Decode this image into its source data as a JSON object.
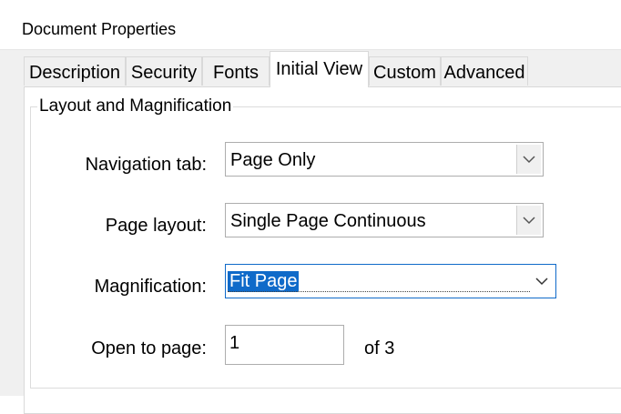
{
  "window": {
    "title": "Document Properties"
  },
  "tabs": [
    {
      "label": "Description",
      "active": false
    },
    {
      "label": "Security",
      "active": false
    },
    {
      "label": "Fonts",
      "active": false
    },
    {
      "label": "Initial View",
      "active": true
    },
    {
      "label": "Custom",
      "active": false
    },
    {
      "label": "Advanced",
      "active": false
    }
  ],
  "group": {
    "title": "Layout and Magnification"
  },
  "fields": {
    "navigation_tab": {
      "label": "Navigation tab:",
      "value": "Page Only"
    },
    "page_layout": {
      "label": "Page layout:",
      "value": "Single Page Continuous"
    },
    "magnification": {
      "label": "Magnification:",
      "value": "Fit Page"
    },
    "open_to_page": {
      "label": "Open to page:",
      "value": "1",
      "suffix": "of 3"
    }
  },
  "icons": {
    "dropdown": "chevron-down-icon"
  },
  "colors": {
    "selection": "#0f6ac9",
    "focus_border": "#0f6ac9"
  }
}
